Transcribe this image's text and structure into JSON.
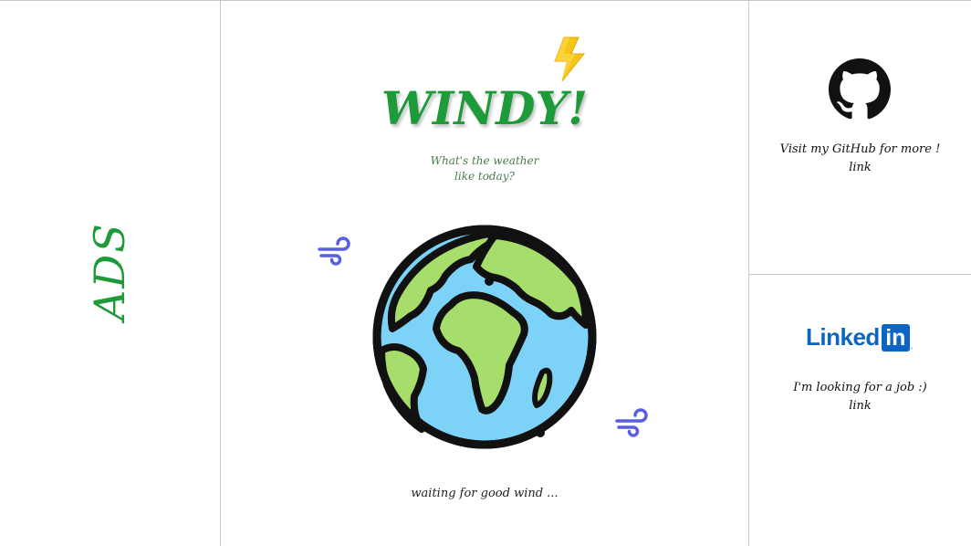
{
  "ads": {
    "label": "ADS"
  },
  "app": {
    "title": "WINDY!",
    "subtitle_line1": "What's the weather",
    "subtitle_line2": "like today?",
    "status": "waiting for good wind ..."
  },
  "github": {
    "text": "Visit my GitHub for more !",
    "link": "link",
    "icon": "github-icon"
  },
  "linkedin": {
    "logo_word": "Linked",
    "logo_box": "in",
    "logo_dot": ".",
    "text": "I'm looking for a job :)",
    "link": "link"
  },
  "colors": {
    "brand_green": "#1f9a3a",
    "linkedin_blue": "#0a66c2",
    "wind_blue": "#5a5fe0",
    "bolt_yellow": "#f5c518"
  }
}
